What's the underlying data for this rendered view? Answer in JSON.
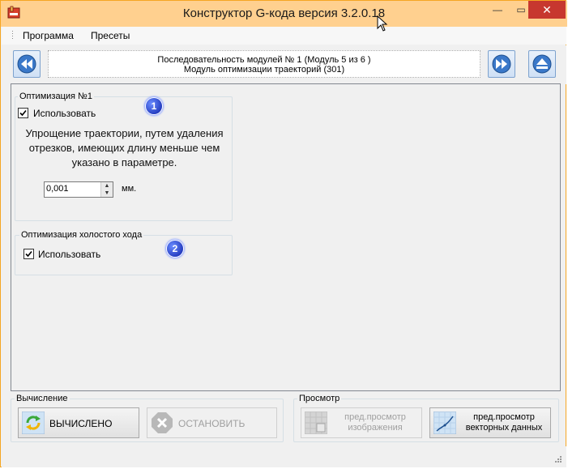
{
  "window": {
    "title": "Конструктор G-кода версия 3.2.0.18",
    "controls": {
      "minimize": "—",
      "maximize": "▭",
      "close": "✕"
    }
  },
  "menu": {
    "items": [
      "Программа",
      "Пресеты"
    ]
  },
  "toolbar": {
    "sequence_line1": "Последовательность модулей № 1 (Модуль 5 из 6 )",
    "sequence_line2": "Модуль оптимизации траекторий (301)"
  },
  "optimization1": {
    "title": "Оптимизация №1",
    "checkbox_label": "Использовать",
    "checked": true,
    "badge": "1",
    "description": "Упрощение траектории, путем удаления отрезков, имеющих длину меньше чем указано в параметре.",
    "value": "0,001",
    "unit": "мм."
  },
  "optimization2": {
    "title": "Оптимизация холостого хода",
    "checkbox_label": "Использовать",
    "checked": true,
    "badge": "2"
  },
  "calculation": {
    "title": "Вычисление",
    "calculated_label": "ВЫЧИСЛЕНО",
    "stop_label": "ОСТАНОВИТЬ"
  },
  "preview": {
    "title": "Просмотр",
    "image_label_line1": "пред.просмотр",
    "image_label_line2": "изображения",
    "vector_label_line1": "пред.просмотр",
    "vector_label_line2": "векторных данных"
  },
  "colors": {
    "titlebar": "#ffd08f",
    "close_button": "#c7372f",
    "window_border": "#f5a623",
    "badge": "#0b1fa8"
  }
}
